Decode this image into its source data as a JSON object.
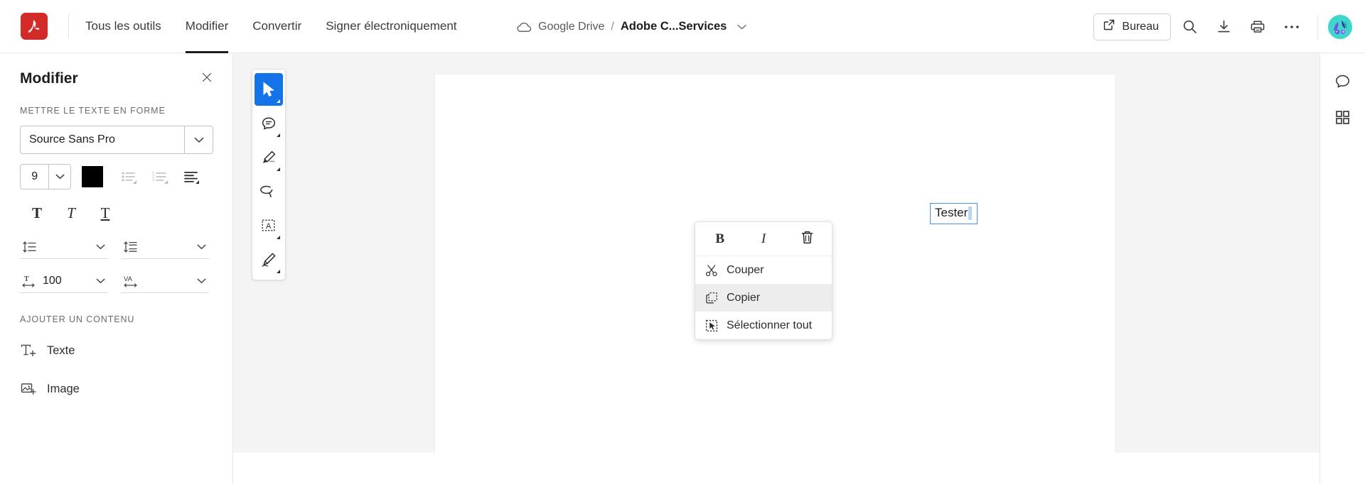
{
  "app": {
    "name": "Adobe Acrobat",
    "logo_icon": "adobe-acrobat-logo",
    "accent_blue": "#1473e6",
    "brand_red": "#d32b27",
    "selection_blue": "#4a90e2"
  },
  "topnav": {
    "items": [
      {
        "label": "Tous les outils",
        "active": false
      },
      {
        "label": "Modifier",
        "active": true
      },
      {
        "label": "Convertir",
        "active": false
      },
      {
        "label": "Signer électroniquement",
        "active": false
      }
    ]
  },
  "breadcrumb": {
    "cloud_icon": "cloud-icon",
    "storage": "Google Drive",
    "separator": "/",
    "document": "Adobe C...Services",
    "chevron_icon": "chevron-down-icon"
  },
  "topbar_actions": {
    "desktop_button": {
      "label": "Bureau",
      "icon": "external-link-icon"
    },
    "search_icon": "search-icon",
    "download_icon": "download-icon",
    "print_icon": "print-icon",
    "more_icon": "more-horizontal-icon",
    "avatar": {
      "icon": "avatar",
      "background": "#3ed6cd"
    }
  },
  "left_panel": {
    "title": "Modifier",
    "close_icon": "close-icon",
    "format_section": {
      "label": "METTRE LE TEXTE EN FORME",
      "font": {
        "value": "Source Sans Pro",
        "chevron_icon": "chevron-down-icon"
      },
      "font_size": {
        "value": "9",
        "chevron_icon": "chevron-down-icon"
      },
      "text_color": {
        "swatch_hex": "#000000",
        "name": "color-swatch"
      },
      "bullet_list": {
        "icon": "bulleted-list-icon",
        "disabled": true
      },
      "numbered_list": {
        "icon": "numbered-list-icon",
        "disabled": true
      },
      "align": {
        "icon": "text-align-left-icon",
        "disabled": false
      },
      "bold": {
        "icon": "bold-icon",
        "glyph": "T"
      },
      "italic": {
        "icon": "italic-icon",
        "glyph": "T"
      },
      "underline": {
        "icon": "underline-icon",
        "glyph": "T"
      },
      "line_spacing": {
        "icon": "line-spacing-icon",
        "value": "",
        "chevron_icon": "chevron-down-icon"
      },
      "paragraph_spacing": {
        "icon": "paragraph-spacing-icon",
        "value": "",
        "chevron_icon": "chevron-down-icon"
      },
      "horizontal_scale": {
        "icon": "horizontal-scale-icon",
        "value": "100",
        "chevron_icon": "chevron-down-icon"
      },
      "letter_spacing": {
        "icon": "letter-spacing-icon",
        "glyph": "VA",
        "value": "",
        "chevron_icon": "chevron-down-icon"
      }
    },
    "add_section": {
      "label": "AJOUTER UN CONTENU",
      "items": [
        {
          "label": "Texte",
          "icon": "add-text-icon"
        },
        {
          "label": "Image",
          "icon": "add-image-icon"
        }
      ]
    }
  },
  "toolrail": {
    "tools": [
      {
        "name": "select-tool",
        "icon": "cursor-arrow-icon",
        "active": true
      },
      {
        "name": "comment-tool",
        "icon": "comment-bubble-icon",
        "active": false
      },
      {
        "name": "highlight-tool",
        "icon": "highlighter-pen-icon",
        "active": false
      },
      {
        "name": "draw-tool",
        "icon": "lasso-loop-icon",
        "active": false
      },
      {
        "name": "text-select-tool",
        "icon": "text-box-select-icon",
        "active": false
      },
      {
        "name": "sign-tool",
        "icon": "signature-pen-icon",
        "active": false
      }
    ]
  },
  "document": {
    "textbox": {
      "value": "Tester",
      "selected": true
    }
  },
  "context_menu": {
    "toolbar": [
      {
        "name": "bold-button",
        "label": "B",
        "icon": "bold-icon"
      },
      {
        "name": "italic-button",
        "label": "I",
        "icon": "italic-icon"
      },
      {
        "name": "delete-button",
        "label": "",
        "icon": "trash-icon"
      }
    ],
    "items": [
      {
        "label": "Couper",
        "icon": "scissors-icon",
        "hovered": false
      },
      {
        "label": "Copier",
        "icon": "copy-icon",
        "hovered": true
      },
      {
        "label": "Sélectionner tout",
        "icon": "select-all-icon",
        "hovered": false
      }
    ]
  },
  "right_rail": {
    "items": [
      {
        "name": "comments-panel",
        "icon": "comment-bubble-icon"
      },
      {
        "name": "all-tools-panel",
        "icon": "grid-four-squares-icon"
      }
    ]
  }
}
